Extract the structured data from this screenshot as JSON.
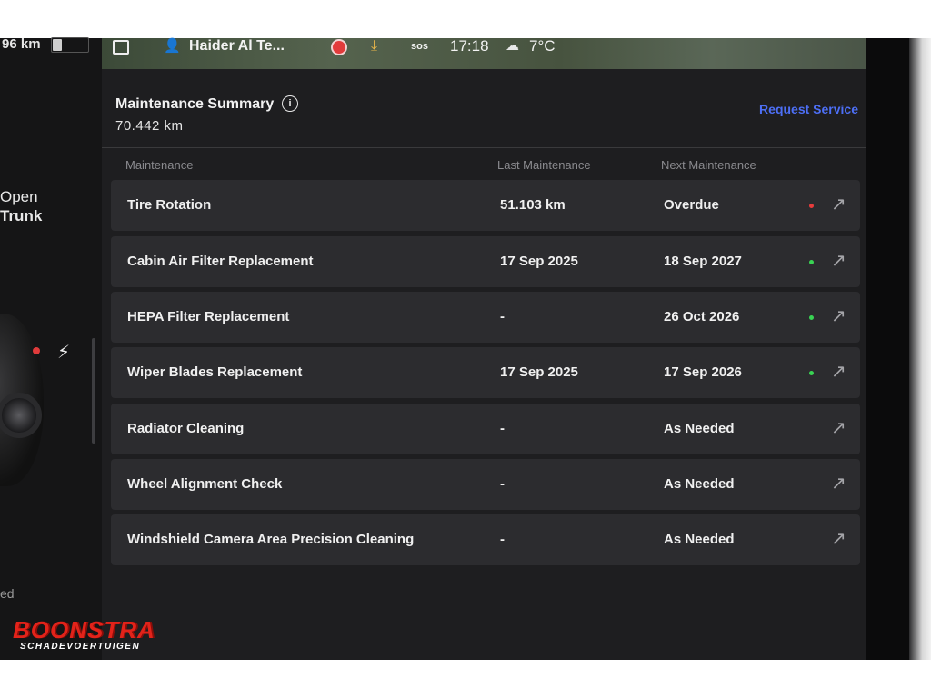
{
  "left_panel": {
    "range": "96 km",
    "trunk_line1": "Open",
    "trunk_line2": "Trunk",
    "status_fragment": "ed"
  },
  "status_bar": {
    "user_name": "Haider Al Te...",
    "sos": "sos",
    "time": "17:18",
    "temperature": "7°C",
    "icons": [
      "lock-icon",
      "person-icon",
      "record-icon",
      "download-icon",
      "sos-icon",
      "cloud-icon"
    ]
  },
  "maintenance": {
    "title": "Maintenance Summary",
    "odometer": "70.442  km",
    "request_label": "Request Service",
    "columns": [
      "Maintenance",
      "Last Maintenance",
      "Next Maintenance"
    ],
    "rows": [
      {
        "name": "Tire Rotation",
        "last": "51.103 km",
        "next": "Overdue",
        "status": "red"
      },
      {
        "name": "Cabin Air Filter Replacement",
        "last": "17 Sep 2025",
        "next": "18 Sep 2027",
        "status": "green"
      },
      {
        "name": "HEPA Filter Replacement",
        "last": "-",
        "next": "26 Oct 2026",
        "status": "green"
      },
      {
        "name": "Wiper Blades Replacement",
        "last": "17 Sep 2025",
        "next": "17 Sep 2026",
        "status": "green"
      },
      {
        "name": "Radiator Cleaning",
        "last": "-",
        "next": "As Needed",
        "status": ""
      },
      {
        "name": "Wheel Alignment Check",
        "last": "-",
        "next": "As Needed",
        "status": ""
      },
      {
        "name": "Windshield Camera Area Precision Cleaning",
        "last": "-",
        "next": "As Needed",
        "status": ""
      }
    ]
  },
  "colors": {
    "accent": "#4d6ff5",
    "overdue": "#e83c3c",
    "ok": "#39d353"
  },
  "watermark": {
    "brand": "BOONSTRA",
    "sub": "SCHADEVOERTUIGEN"
  }
}
